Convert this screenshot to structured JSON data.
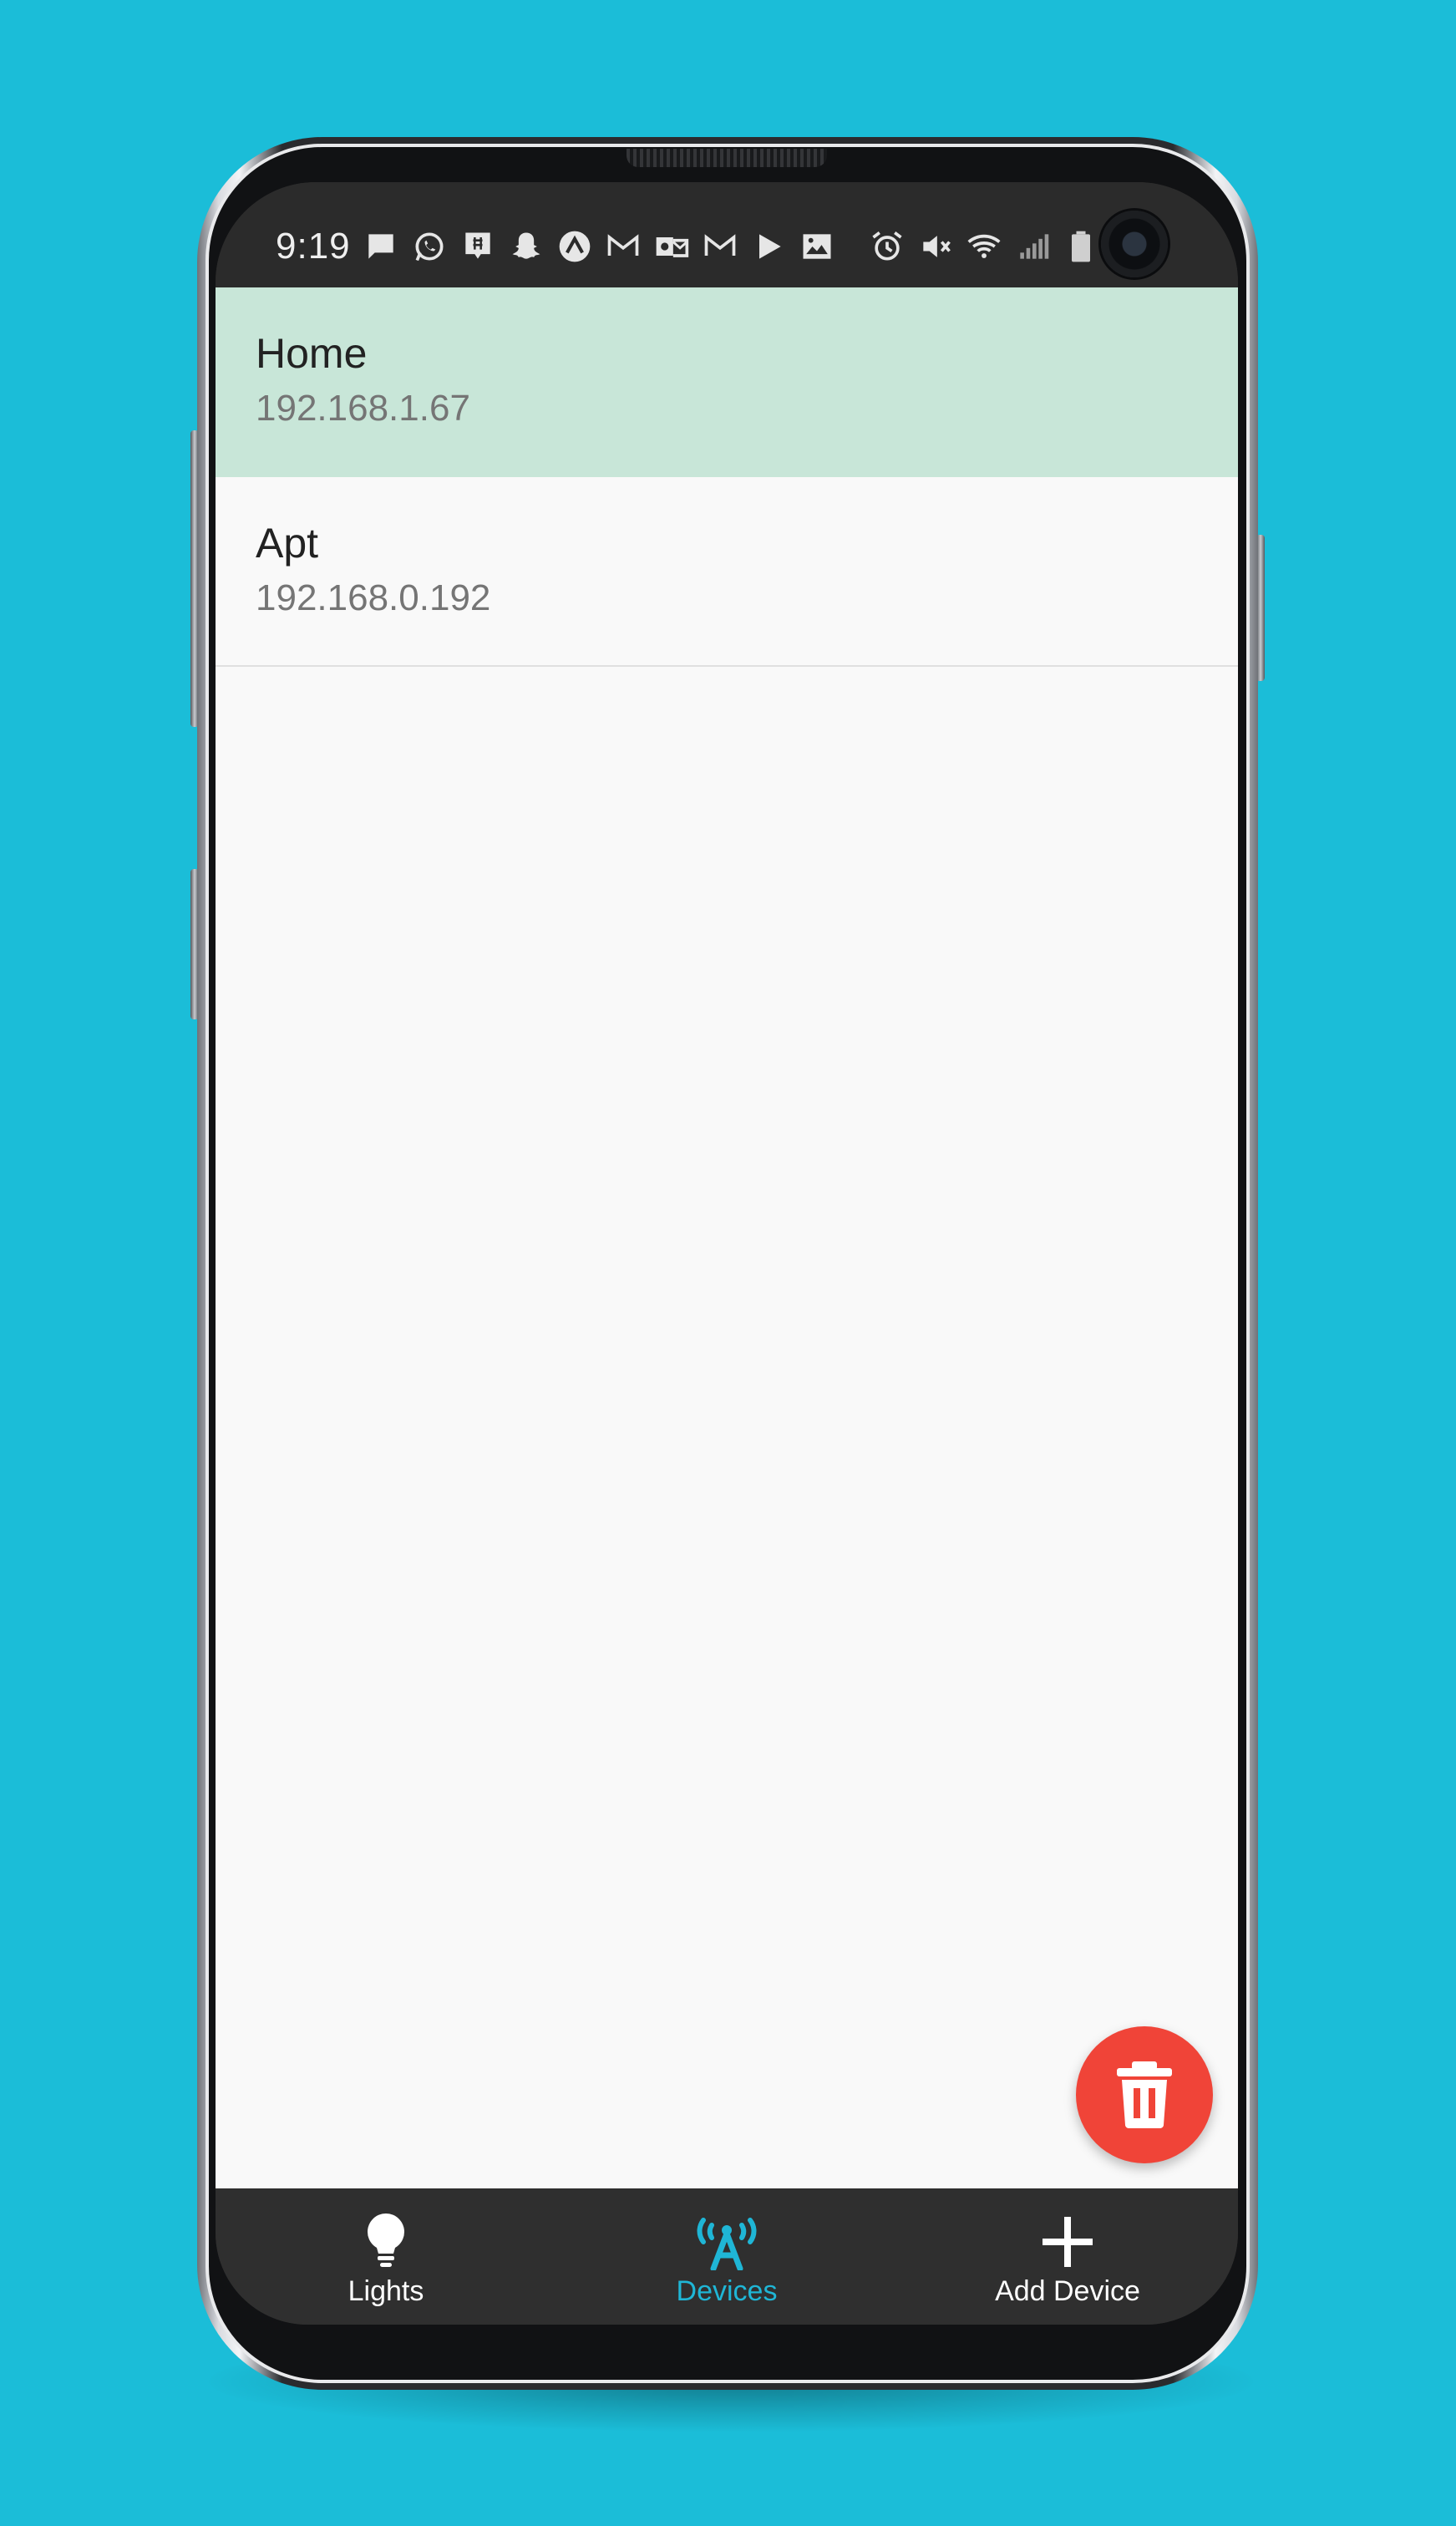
{
  "status_bar": {
    "time": "9:19",
    "left_icons": [
      "message-icon",
      "whatsapp-icon",
      "chat-bubble-icon",
      "snapchat-icon",
      "app-circle-icon",
      "gmail-icon",
      "outlook-icon",
      "gmail-icon",
      "play-store-icon",
      "gallery-icon"
    ],
    "right_icons": [
      "alarm-icon",
      "vibrate-mute-icon",
      "wifi-icon",
      "signal-icon",
      "battery-icon"
    ]
  },
  "devices": [
    {
      "name": "Home",
      "ip": "192.168.1.67",
      "selected": true
    },
    {
      "name": "Apt",
      "ip": "192.168.0.192",
      "selected": false
    }
  ],
  "fab": {
    "icon": "trash-icon"
  },
  "bottom_nav": {
    "items": [
      {
        "label": "Lights",
        "icon": "lightbulb-icon",
        "active": false
      },
      {
        "label": "Devices",
        "icon": "antenna-icon",
        "active": true
      },
      {
        "label": "Add Device",
        "icon": "plus-icon",
        "active": false
      }
    ]
  },
  "colors": {
    "background": "#1bbdd8",
    "selected_row": "#c8e6d8",
    "fab": "#f04438",
    "nav_active": "#1fb6d6",
    "nav_bar": "#2f2f2f"
  }
}
